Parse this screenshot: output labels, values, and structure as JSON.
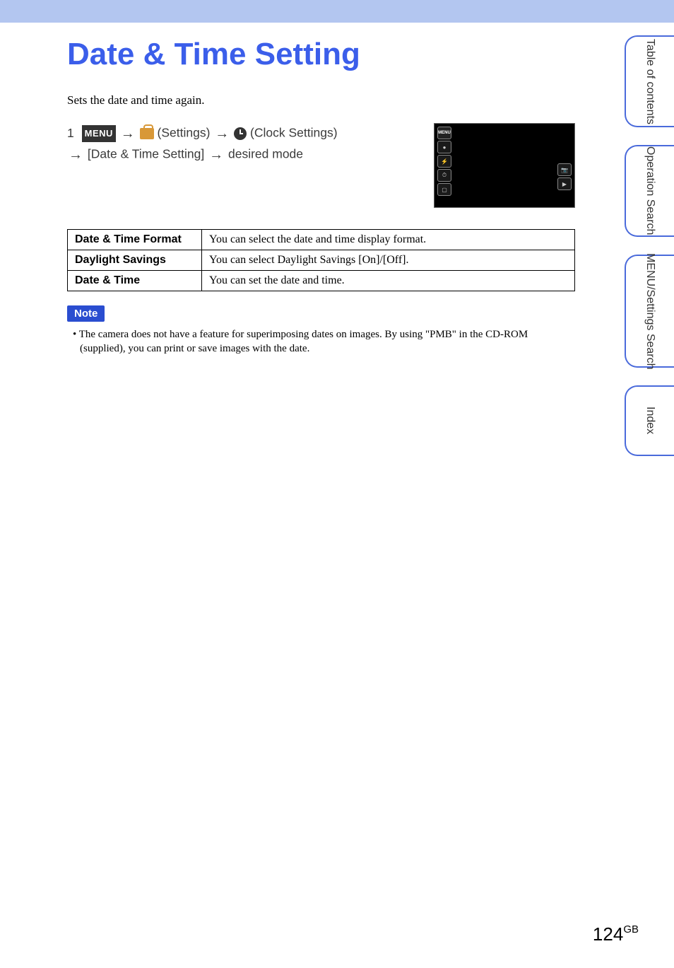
{
  "title": "Date & Time Setting",
  "intro": "Sets the date and time again.",
  "navigation": {
    "step": "1",
    "menu_label": "MENU",
    "settings_label": "(Settings)",
    "clock_label": "(Clock Settings)",
    "path_label": "[Date & Time Setting]",
    "desired": "desired mode"
  },
  "table": {
    "rows": [
      {
        "label": "Date & Time Format",
        "desc": "You can select the date and time display format."
      },
      {
        "label": "Daylight Savings",
        "desc": "You can select Daylight Savings [On]/[Off]."
      },
      {
        "label": "Date & Time",
        "desc": "You can set the date and time."
      }
    ]
  },
  "note": {
    "badge": "Note",
    "text": "The camera does not have a feature for superimposing dates on images. By using \"PMB\" in the CD-ROM (supplied), you can print or save images with the date."
  },
  "side_tabs": [
    "Table of\ncontents",
    "Operation\nSearch",
    "MENU/Settings\nSearch",
    "Index"
  ],
  "page_num": "124",
  "page_suffix": "GB"
}
